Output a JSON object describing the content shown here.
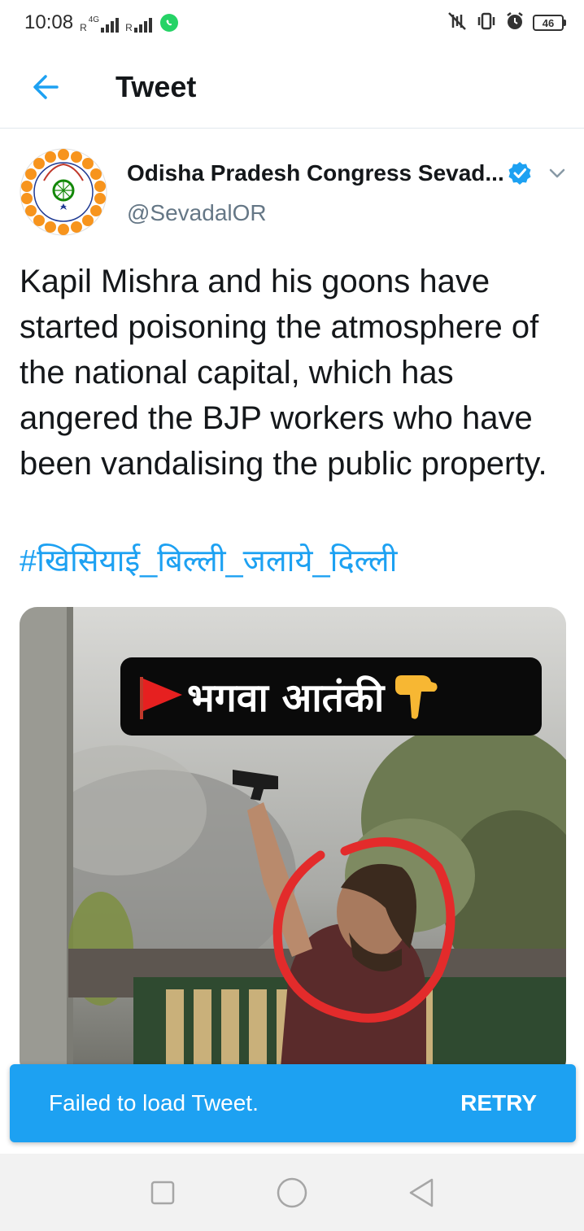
{
  "status_bar": {
    "time": "10:08",
    "network_type": "4G",
    "sim1_letter": "R",
    "sim2_letter": "R",
    "battery_level": "46",
    "icons": [
      "whatsapp-icon",
      "mute-vibrate-icon",
      "vibrate-icon",
      "alarm-icon",
      "battery-icon"
    ]
  },
  "header": {
    "title": "Tweet",
    "back_icon": "arrow-left-icon"
  },
  "tweet": {
    "author_name": "Odisha Pradesh Congress Sevad...",
    "author_handle": "@SevadalOR",
    "verified": true,
    "text": "Kapil Mishra and his goons have started poisoning the atmosphere of the national capital, which has angered the BJP workers who have been vandalising the public property.",
    "hashtag": "#खिसियाई_बिल्ली_जलाये_दिल्ली",
    "media": {
      "banner_text": "भगवा आतंकी",
      "banner_icons": [
        "red-flag-icon",
        "pointing-down-hand-icon"
      ]
    }
  },
  "toast": {
    "message": "Failed to load Tweet.",
    "action": "RETRY"
  },
  "nav_bar": {
    "icons": [
      "recents-square-icon",
      "home-circle-icon",
      "back-triangle-icon"
    ]
  },
  "colors": {
    "accent": "#1da1f2",
    "text_primary": "#14171a",
    "text_secondary": "#657786"
  }
}
